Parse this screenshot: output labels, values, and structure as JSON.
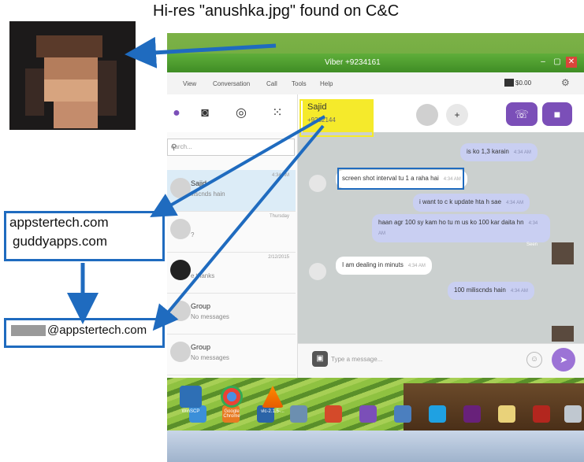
{
  "annotation": {
    "caption": "Hi-res \"anushka.jpg\" found on C&C",
    "domains": [
      "appstertech.com",
      "guddyapps.com"
    ],
    "email_suffix": "@appstertech.com"
  },
  "window": {
    "title": "Viber +9234161",
    "minimize": "–",
    "maximize": "▢",
    "close": "✕"
  },
  "menu": {
    "items": [
      "View",
      "Conversation",
      "Call",
      "Tools",
      "Help"
    ],
    "balance": "$0.00"
  },
  "search": {
    "placeholder": "earch..."
  },
  "contacts": [
    {
      "name": "Sajid",
      "sub": "iliscnds hain",
      "time": "4:34 AM"
    },
    {
      "name": "",
      "sub": "?",
      "time": "Thursday"
    },
    {
      "name": "",
      "sub": "e thanks",
      "time": "2/12/2015"
    },
    {
      "name": "Group",
      "sub": "No messages",
      "time": ""
    },
    {
      "name": "Group",
      "sub": "No messages",
      "time": ""
    }
  ],
  "chat_header": {
    "name": "Sajid",
    "phone": "+9232144"
  },
  "messages": [
    {
      "dir": "out",
      "text": "is ko 1,3 karain",
      "time": "4:34 AM"
    },
    {
      "dir": "in",
      "text": "screen shot interval tu 1 a raha hai",
      "time": "4:34 AM"
    },
    {
      "dir": "out",
      "text": "i want to c k update hta h sae",
      "time": "4:34 AM"
    },
    {
      "dir": "out",
      "text": "haan agr 100 sy kam ho tu m us ko 100 kar daita hn",
      "time": "4:34 AM"
    },
    {
      "dir": "in",
      "text": "I am dealing in minuts",
      "time": "4:34 AM"
    },
    {
      "dir": "out",
      "text": "100 miliscnds hain",
      "time": "4:34 AM"
    }
  ],
  "seen_label": "Seen",
  "input": {
    "placeholder": "Type a message..."
  },
  "desktop_icons": [
    {
      "label": "WinSCP"
    },
    {
      "label": "Google Chrome"
    },
    {
      "label": "vlc-2.1.5-..."
    }
  ],
  "colors": {
    "viber_purple": "#7b4fb8",
    "annotation_blue": "#1f6bbf",
    "highlight_yellow": "#f5ea2b"
  }
}
